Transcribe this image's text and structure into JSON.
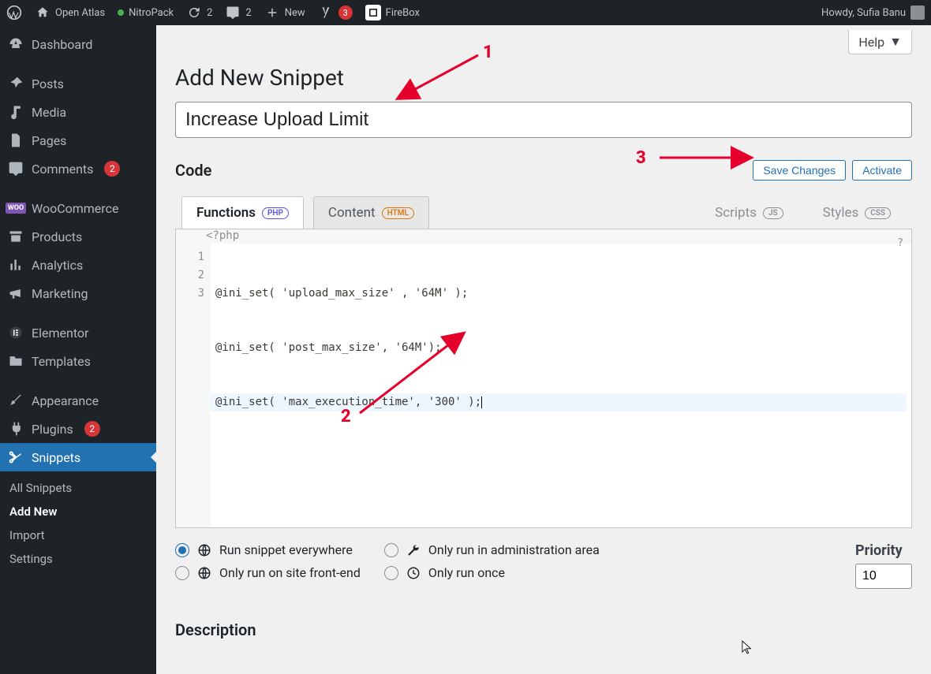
{
  "adminbar": {
    "site": "Open Atlas",
    "nitropack": "NitroPack",
    "updates": "2",
    "comments": "2",
    "new": "New",
    "yoast_badge": "3",
    "firebox": "FireBox",
    "howdy": "Howdy, Sufia Banu"
  },
  "sidebar": {
    "items": [
      {
        "label": "Dashboard"
      },
      {
        "label": "Posts"
      },
      {
        "label": "Media"
      },
      {
        "label": "Pages"
      },
      {
        "label": "Comments",
        "badge": "2"
      },
      {
        "label": "WooCommerce"
      },
      {
        "label": "Products"
      },
      {
        "label": "Analytics"
      },
      {
        "label": "Marketing"
      },
      {
        "label": "Elementor"
      },
      {
        "label": "Templates"
      },
      {
        "label": "Appearance"
      },
      {
        "label": "Plugins",
        "badge": "2"
      },
      {
        "label": "Snippets"
      }
    ],
    "subitems": [
      "All Snippets",
      "Add New",
      "Import",
      "Settings"
    ],
    "current_sub": "Add New"
  },
  "page": {
    "help": "Help",
    "title": "Add New Snippet",
    "title_value": "Increase Upload Limit",
    "code_heading": "Code",
    "save": "Save Changes",
    "activate": "Activate",
    "tabs": {
      "functions": "Functions",
      "functions_badge": "PHP",
      "content": "Content",
      "content_badge": "HTML",
      "scripts": "Scripts",
      "scripts_badge": "JS",
      "styles": "Styles",
      "styles_badge": "CSS"
    },
    "editor": {
      "prefix": "<?php",
      "help": "?",
      "lines": [
        "@ini_set( 'upload_max_size' , '64M' );",
        "@ini_set( 'post_max_size', '64M');",
        "@ini_set( 'max_execution_time', '300' );"
      ],
      "line_numbers": [
        "1",
        "2",
        "3"
      ]
    },
    "run_options": [
      "Run snippet everywhere",
      "Only run in administration area",
      "Only run on site front-end",
      "Only run once"
    ],
    "priority_label": "Priority",
    "priority_value": "10",
    "description_heading": "Description"
  },
  "annotations": {
    "n1": "1",
    "n2": "2",
    "n3": "3"
  }
}
